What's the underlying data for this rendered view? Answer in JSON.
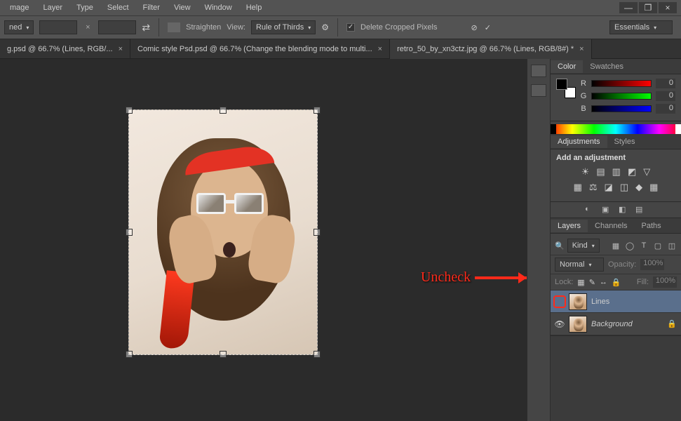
{
  "menubar": {
    "items": [
      "mage",
      "Layer",
      "Type",
      "Select",
      "Filter",
      "View",
      "Window",
      "Help"
    ]
  },
  "window_controls": {
    "min": "—",
    "max": "❐",
    "close": "×"
  },
  "optionsbar": {
    "preset_label": "ned",
    "width": "",
    "height": "",
    "clear": "×",
    "swap": "⇄",
    "straighten": "Straighten",
    "view_label": "View:",
    "view_value": "Rule of Thirds",
    "gear": "⚙",
    "delete_cropped": "Delete Cropped Pixels",
    "cancel": "⊘",
    "commit": "✓",
    "workspace": "Essentials",
    "search": "🔍"
  },
  "tabs": [
    {
      "label": "g.psd @ 66.7% (Lines, RGB/...",
      "active": false
    },
    {
      "label": "Comic style Psd.psd @ 66.7% (Change the blending mode to multi...",
      "active": false
    },
    {
      "label": "retro_50_by_xn3ctz.jpg @ 66.7% (Lines, RGB/8#) *",
      "active": true
    }
  ],
  "callout": "Uncheck",
  "color_panel": {
    "tabs": [
      "Color",
      "Swatches"
    ],
    "channels": [
      {
        "ch": "R",
        "val": "0"
      },
      {
        "ch": "G",
        "val": "0"
      },
      {
        "ch": "B",
        "val": "0"
      }
    ]
  },
  "adjustments_panel": {
    "tabs": [
      "Adjustments",
      "Styles"
    ],
    "title": "Add an adjustment",
    "row1": [
      "☀",
      "▤",
      "▥",
      "◩",
      "▽"
    ],
    "row2": [
      "▦",
      "⚖",
      "◪",
      "◫",
      "◆",
      "▦"
    ],
    "bottom": [
      "◐",
      "▣",
      "◧",
      "▤"
    ]
  },
  "layers_panel": {
    "tabs": [
      "Layers",
      "Channels",
      "Paths"
    ],
    "filter_kind": "Kind",
    "filter_icons": [
      "▦",
      "◯",
      "T",
      "▢",
      "◫"
    ],
    "blend_mode": "Normal",
    "opacity_label": "Opacity:",
    "opacity_value": "100%",
    "lock_label": "Lock:",
    "lock_icons": [
      "▦",
      "✎",
      "↔",
      "🔒"
    ],
    "fill_label": "Fill:",
    "fill_value": "100%",
    "layers": [
      {
        "visible": false,
        "name": "Lines",
        "selected": true,
        "locked": false,
        "italic": false
      },
      {
        "visible": true,
        "name": "Background",
        "selected": false,
        "locked": true,
        "italic": true
      }
    ]
  }
}
